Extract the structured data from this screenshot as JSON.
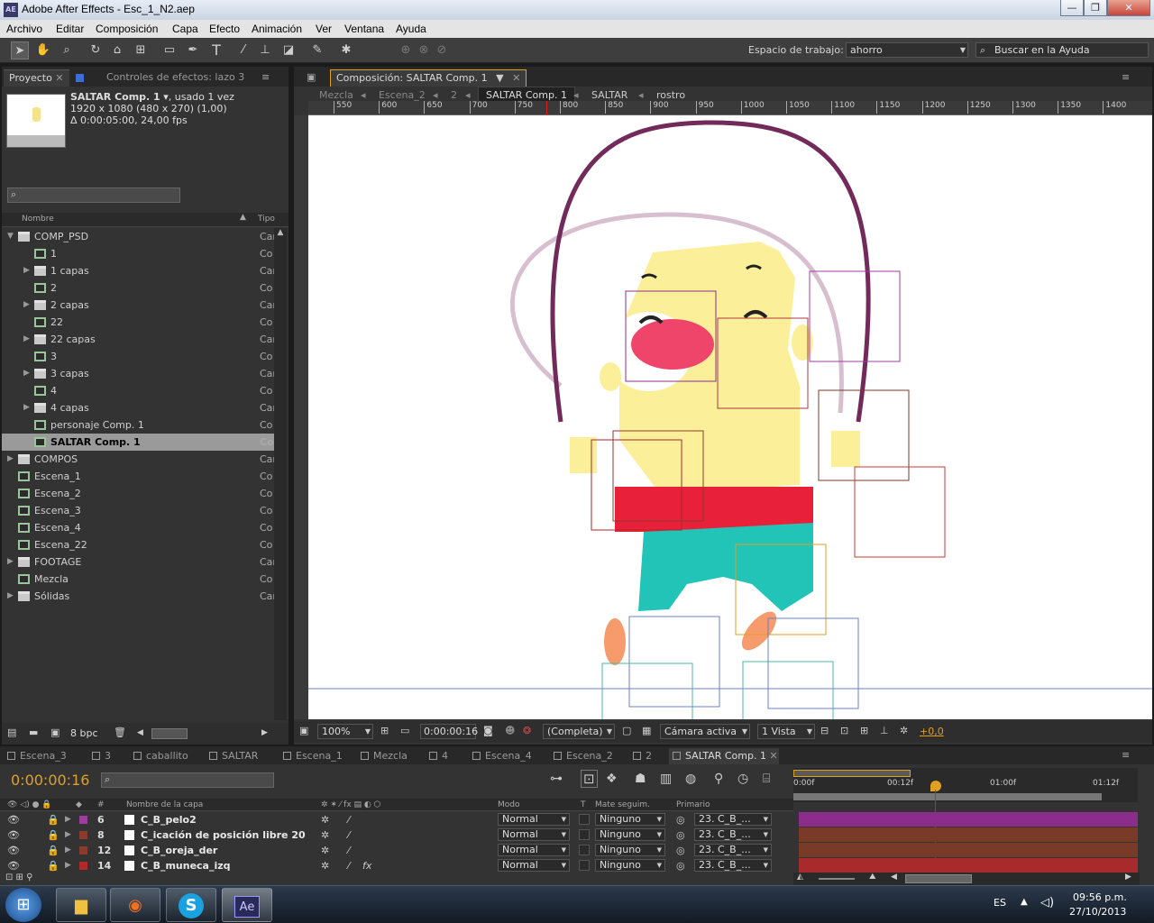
{
  "window": {
    "title": "Adobe After Effects - Esc_1_N2.aep",
    "app_icon": "AE"
  },
  "menu": [
    "Archivo",
    "Editar",
    "Composición",
    "Capa",
    "Efecto",
    "Animación",
    "Ver",
    "Ventana",
    "Ayuda"
  ],
  "toolbar": {
    "workspace_label": "Espacio de trabajo:",
    "workspace_value": "ahorro",
    "search_placeholder": "Buscar en la Ayuda"
  },
  "project_panel": {
    "tabs": [
      "Proyecto",
      "Controles de efectos: lazo 3"
    ],
    "selected_item": {
      "name": "SALTAR Comp. 1",
      "usage": ", usado 1 vez",
      "size": "1920 x 1080  (480 x 270) (1,00)",
      "duration": "Δ 0:00:05:00, 24,00 fps"
    },
    "columns": {
      "name": "Nombre",
      "type": "Tipo"
    },
    "items": [
      {
        "label": "COMP_PSD",
        "type": "Car",
        "kind": "folder",
        "level": 0,
        "expanded": true
      },
      {
        "label": "1",
        "type": "Co",
        "kind": "comp",
        "level": 1
      },
      {
        "label": "1 capas",
        "type": "Car",
        "kind": "folder",
        "level": 1
      },
      {
        "label": "2",
        "type": "Co",
        "kind": "comp",
        "level": 1
      },
      {
        "label": "2 capas",
        "type": "Car",
        "kind": "folder",
        "level": 1
      },
      {
        "label": "22",
        "type": "Co",
        "kind": "comp",
        "level": 1
      },
      {
        "label": "22 capas",
        "type": "Car",
        "kind": "folder",
        "level": 1
      },
      {
        "label": "3",
        "type": "Co",
        "kind": "comp",
        "level": 1
      },
      {
        "label": "3 capas",
        "type": "Car",
        "kind": "folder",
        "level": 1
      },
      {
        "label": "4",
        "type": "Co",
        "kind": "comp",
        "level": 1
      },
      {
        "label": "4 capas",
        "type": "Car",
        "kind": "folder",
        "level": 1
      },
      {
        "label": "personaje Comp. 1",
        "type": "Co",
        "kind": "comp",
        "level": 1
      },
      {
        "label": "SALTAR Comp. 1",
        "type": "Co",
        "kind": "comp",
        "level": 1,
        "selected": true
      },
      {
        "label": "COMPOS",
        "type": "Car",
        "kind": "folder",
        "level": 0
      },
      {
        "label": "Escena_1",
        "type": "Co",
        "kind": "comp",
        "level": 0
      },
      {
        "label": "Escena_2",
        "type": "Co",
        "kind": "comp",
        "level": 0
      },
      {
        "label": "Escena_3",
        "type": "Co",
        "kind": "comp",
        "level": 0
      },
      {
        "label": "Escena_4",
        "type": "Co",
        "kind": "comp",
        "level": 0
      },
      {
        "label": "Escena_22",
        "type": "Co",
        "kind": "comp",
        "level": 0
      },
      {
        "label": "FOOTAGE",
        "type": "Car",
        "kind": "folder",
        "level": 0
      },
      {
        "label": "Mezcla",
        "type": "Co",
        "kind": "comp",
        "level": 0
      },
      {
        "label": "Sólidas",
        "type": "Car",
        "kind": "folder",
        "level": 0
      }
    ],
    "bpc": "8 bpc"
  },
  "composition_panel": {
    "tab": "Composición: SALTAR Comp. 1",
    "breadcrumbs": [
      "Mezcla",
      "Escena_2",
      "2",
      "SALTAR Comp. 1",
      "SALTAR",
      "rostro"
    ],
    "ruler_labels": [
      "550",
      "600",
      "650",
      "700",
      "750",
      "800",
      "850",
      "900",
      "950",
      "1000",
      "1050",
      "1100",
      "1150",
      "1200",
      "1250",
      "1300",
      "1350",
      "1400"
    ],
    "zoom": "100%",
    "timecode": "0:00:00:16",
    "resolution": "(Completa)",
    "camera": "Cámara activa",
    "views": "1 Vista",
    "exposure": "+0,0"
  },
  "timeline_tabs": [
    "Escena_3",
    "3",
    "caballito",
    "SALTAR",
    "Escena_1",
    "Mezcla",
    "4",
    "Escena_4",
    "Escena_2",
    "2",
    "SALTAR Comp. 1"
  ],
  "timeline": {
    "current_time": "0:00:00:16",
    "columns": {
      "layer_name": "Nombre de la capa",
      "mode": "Modo",
      "t": "T",
      "track_matte": "Mate seguim.",
      "parent": "Primario",
      "hash": "#"
    },
    "time_marks": [
      "0:00f",
      "00:12f",
      "01:00f",
      "01:12f"
    ],
    "layers": [
      {
        "num": "6",
        "name": "C_B_pelo2",
        "mode": "Normal",
        "matte": "Ninguno",
        "parent": "23. C_B_...",
        "color": "#a03ca0",
        "bar": "#8c2d8c"
      },
      {
        "num": "8",
        "name": "C_icación de posición libre 20",
        "mode": "Normal",
        "matte": "Ninguno",
        "parent": "23. C_B_...",
        "color": "#8a3c2c",
        "bar": "#7a3a28"
      },
      {
        "num": "12",
        "name": "C_B_oreja_der",
        "mode": "Normal",
        "matte": "Ninguno",
        "parent": "23. C_B_...",
        "color": "#8a3c2c",
        "bar": "#7a3a28"
      },
      {
        "num": "14",
        "name": "C_B_muneca_izq",
        "mode": "Normal",
        "matte": "Ninguno",
        "parent": "23. C_B_...",
        "color": "#b02a2a",
        "bar": "#a82a2a"
      }
    ]
  },
  "taskbar": {
    "language": "ES",
    "time": "09:56 p.m.",
    "date": "27/10/2013",
    "ae_label": "Ae"
  }
}
